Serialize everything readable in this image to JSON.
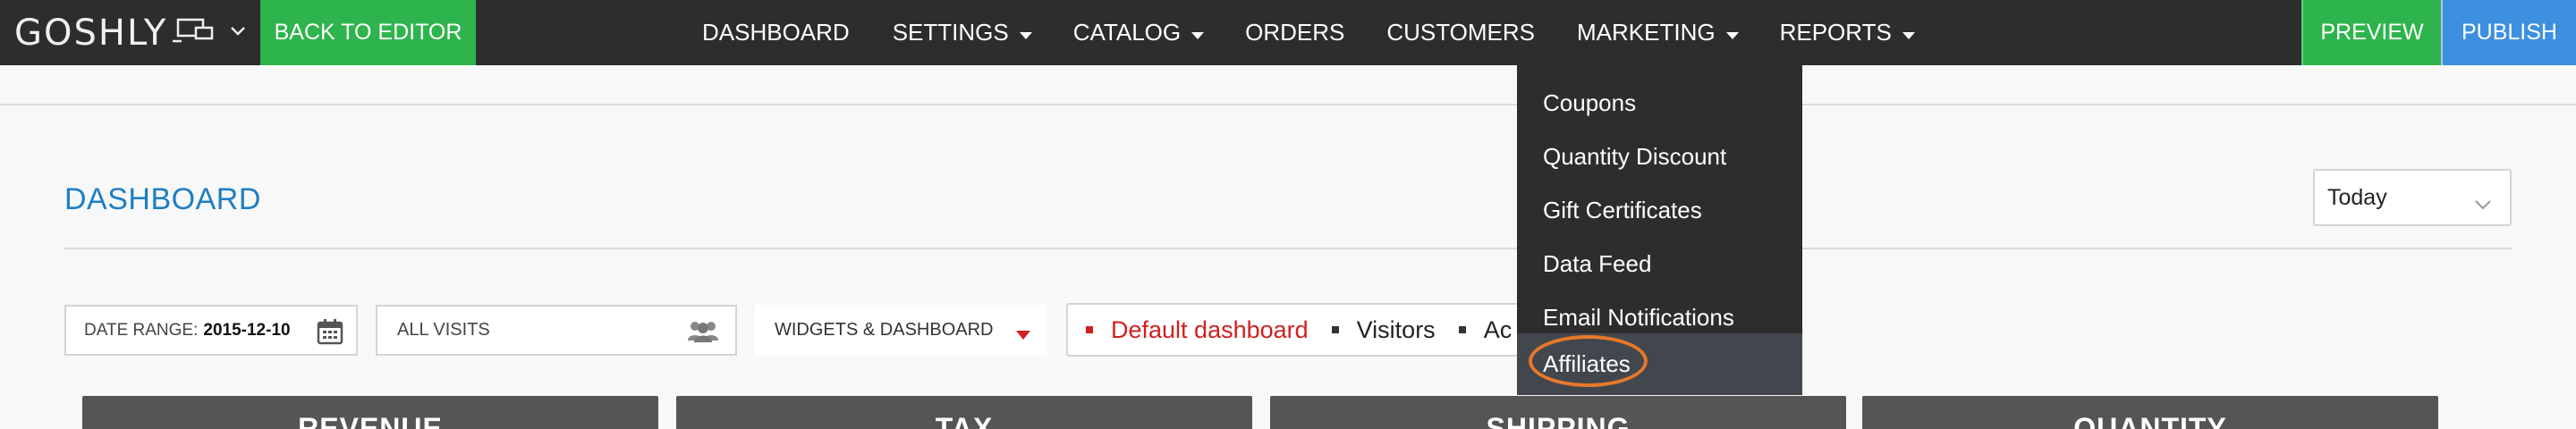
{
  "topbar": {
    "logo_text": "GOSHLY",
    "back_label": "BACK TO EDITOR",
    "nav_items": [
      {
        "label": "DASHBOARD",
        "caret": false
      },
      {
        "label": "SETTINGS",
        "caret": true
      },
      {
        "label": "CATALOG",
        "caret": true
      },
      {
        "label": "ORDERS",
        "caret": false
      },
      {
        "label": "CUSTOMERS",
        "caret": false
      },
      {
        "label": "MARKETING",
        "caret": true
      },
      {
        "label": "REPORTS",
        "caret": true
      }
    ],
    "preview_label": "PREVIEW",
    "publish_label": "PUBLISH"
  },
  "marketing_menu": {
    "items": [
      "Coupons",
      "Quantity Discount",
      "Gift Certificates",
      "Data Feed",
      "Email Notifications",
      "Affiliates"
    ],
    "hovered_item": "Affiliates"
  },
  "page": {
    "title": "DASHBOARD",
    "period": "Today"
  },
  "filters": {
    "date_range_label": "DATE RANGE:",
    "date_range_value": "2015-12-10",
    "visits_label": "ALL VISITS",
    "widgets_label": "WIDGETS & DASHBOARD"
  },
  "dashboard_tabs": [
    {
      "label": "Default dashboard",
      "active": true
    },
    {
      "label": "Visitors",
      "active": false
    },
    {
      "label": "Ac",
      "active": false
    }
  ],
  "cards": [
    "REVENUE",
    "TAX",
    "SHIPPING",
    "QUANTITY"
  ],
  "colors": {
    "topbar_bg": "#2d2d2d",
    "green_button": "#2eb44c",
    "publish_blue": "#3d8fe0",
    "title_blue": "#1f7fc3",
    "active_tab_red": "#d11f1f",
    "highlight_ring": "#e8782a",
    "card_bg": "#555555"
  }
}
